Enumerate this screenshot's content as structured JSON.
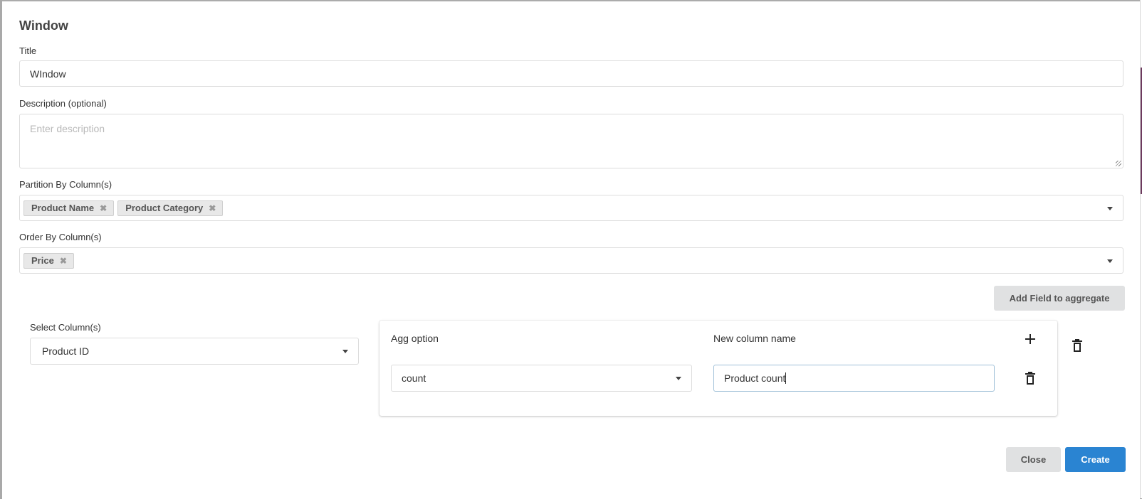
{
  "dialog": {
    "title": "Window"
  },
  "fields": {
    "title": {
      "label": "Title",
      "value": "WIndow"
    },
    "description": {
      "label": "Description (optional)",
      "value": "",
      "placeholder": "Enter description"
    },
    "partition_by": {
      "label": "Partition By Column(s)",
      "tags": [
        "Product Name",
        "Product Category"
      ]
    },
    "order_by": {
      "label": "Order By Column(s)",
      "tags": [
        "Price"
      ]
    }
  },
  "aggregate": {
    "add_button": "Add Field to aggregate",
    "select_column": {
      "label": "Select Column(s)",
      "value": "Product ID"
    },
    "agg_option": {
      "header": "Agg option",
      "value": "count"
    },
    "new_column_name": {
      "header": "New column name",
      "value": "Product count"
    }
  },
  "icons": {
    "remove_tag": "✖",
    "add": "plus-icon",
    "delete": "trash-icon",
    "dropdown": "caret-down-icon"
  },
  "footer": {
    "close": "Close",
    "create": "Create"
  },
  "colors": {
    "primary": "#2a84d2",
    "secondary_button": "#e0e1e2"
  }
}
